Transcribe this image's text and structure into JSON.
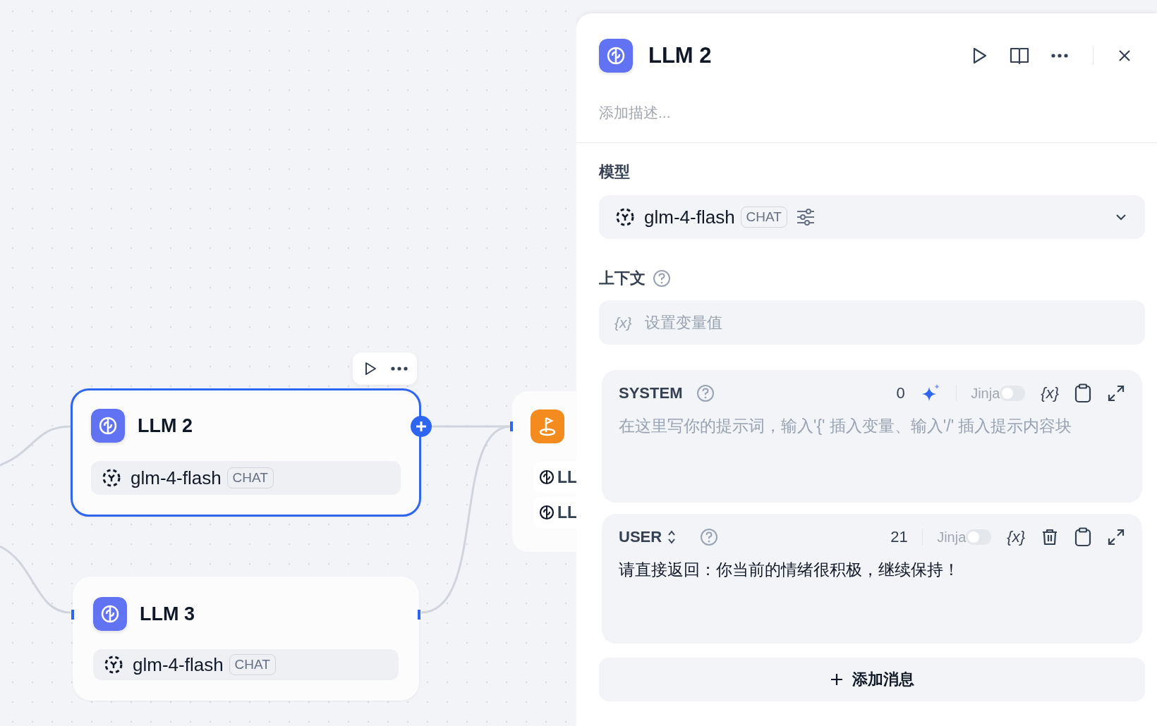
{
  "canvas": {
    "nodes": [
      {
        "kind": "llm",
        "title": "LLM 2",
        "selected": true,
        "model": "glm-4-flash",
        "mode": "CHAT"
      },
      {
        "kind": "llm",
        "title": "LLM 3",
        "selected": false,
        "model": "glm-4-flash",
        "mode": "CHAT"
      },
      {
        "kind": "end",
        "items": [
          "LL",
          "LL"
        ]
      }
    ]
  },
  "panel": {
    "title": "LLM 2",
    "description": {
      "placeholder": "添加描述..."
    },
    "model_label": "模型",
    "model": {
      "name": "glm-4-flash",
      "mode": "CHAT"
    },
    "context_label": "上下文",
    "context_field": {
      "icon": "{x}",
      "placeholder": "设置变量值"
    },
    "messages": [
      {
        "role": "SYSTEM",
        "role_switchable": false,
        "count": "0",
        "generate": true,
        "jinja_label": "Jinja",
        "jinja": false,
        "variable_button": "{x}",
        "deletable": false,
        "placeholder": "在这里写你的提示词，输入'{' 插入变量、输入'/' 插入提示内容块"
      },
      {
        "role": "USER",
        "role_switchable": true,
        "count": "21",
        "generate": false,
        "jinja_label": "Jinja",
        "jinja": false,
        "variable_button": "{x}",
        "deletable": true,
        "value": "请直接返回：你当前的情绪很积极，继续保持！"
      }
    ],
    "add_message": "添加消息"
  }
}
